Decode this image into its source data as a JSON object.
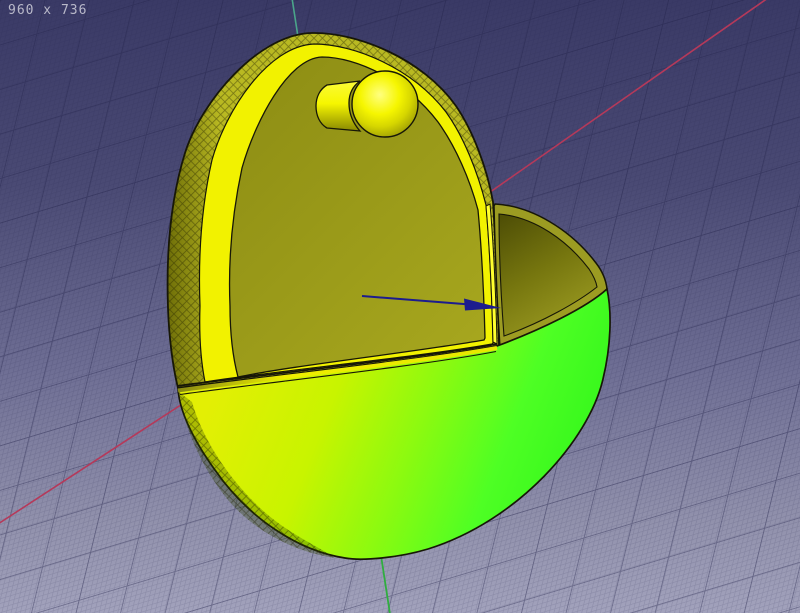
{
  "viewport": {
    "size_label": "960 x 736",
    "bg_top_color": "#3a3a66",
    "bg_bottom_color": "#a2a2bc"
  },
  "axes": {
    "x_axis_color": "#b5395a",
    "vertical_axis_top_color": "#4aa58a",
    "vertical_axis_bottom_color": "#2fae3f"
  },
  "model": {
    "plate_rim_color": "#f2f200",
    "plate_face_top_color": "#8e8e14",
    "plate_face_bottom_color": "#a6a61e",
    "plate_side_dark_color": "#6f6f08",
    "plate_side_light_color": "#b9b922",
    "edge_highlight_color": "#ffff2e",
    "wall_edge_color": "#9c9c22",
    "inner_wall_dark_color": "#4f4f06",
    "inner_wall_light_color": "#9c9c22",
    "bowl_top_color": "#e3ef04",
    "bowl_bottom_color": "#3bf91e",
    "knob_color": "#f6f600"
  },
  "arrow": {
    "color": "#1c1c8e"
  }
}
